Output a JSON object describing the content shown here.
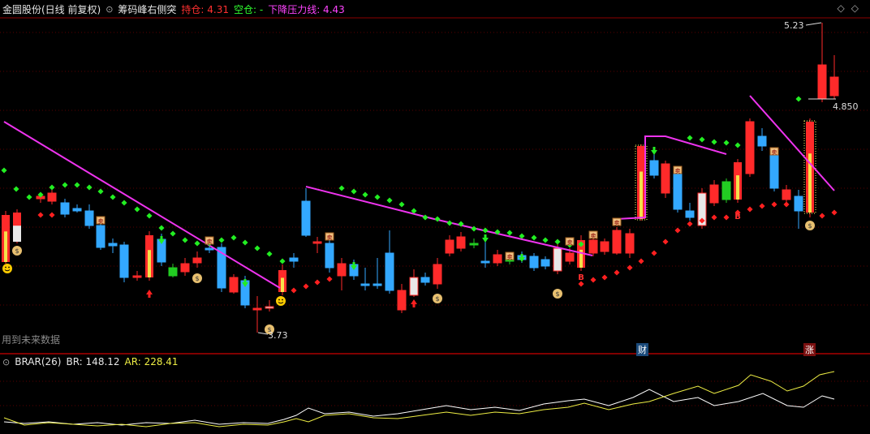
{
  "header": {
    "stock_title": "金圆股份(日线 前复权)",
    "indicator_name": "筹码峰右侧突",
    "hold_label": "持仓: 4.31",
    "empty_label": "空仓: -",
    "pressure_label": "下降压力线: 4.43"
  },
  "price_labels": {
    "high": "5.23",
    "low": "3.73",
    "last_close": "4.850"
  },
  "note": "用到未来数据",
  "markers": {
    "cai": "财",
    "zhang": "涨"
  },
  "sub_panel": {
    "name": "BRAR(26)",
    "br_label": "BR: 148.12",
    "ar_label": "AR: 228.41"
  },
  "colors": {
    "up": "#ff2a2a",
    "down": "#33a8ff",
    "pressure": "#ee33ee",
    "support_green": "#22ee22",
    "support_red": "#ff2020",
    "br": "#ffffff",
    "ar": "#eeee44"
  }
}
